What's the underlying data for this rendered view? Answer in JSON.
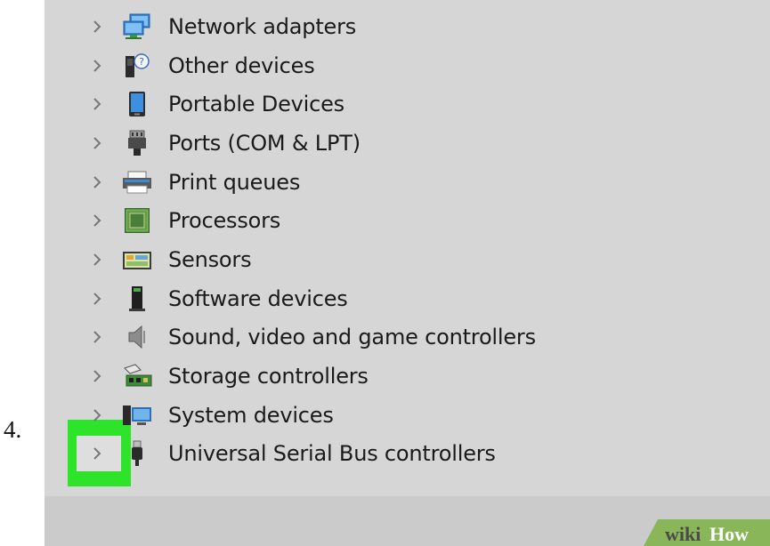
{
  "step": {
    "number": "4."
  },
  "device_tree": {
    "items": [
      {
        "label": "Network adapters",
        "icon": "network-adapter-icon"
      },
      {
        "label": "Other devices",
        "icon": "unknown-device-icon"
      },
      {
        "label": "Portable Devices",
        "icon": "portable-device-icon"
      },
      {
        "label": "Ports (COM & LPT)",
        "icon": "port-icon"
      },
      {
        "label": "Print queues",
        "icon": "printer-icon"
      },
      {
        "label": "Processors",
        "icon": "processor-icon"
      },
      {
        "label": "Sensors",
        "icon": "sensor-icon"
      },
      {
        "label": "Software devices",
        "icon": "software-device-icon"
      },
      {
        "label": "Sound, video and game controllers",
        "icon": "speaker-icon"
      },
      {
        "label": "Storage controllers",
        "icon": "storage-controller-icon"
      },
      {
        "label": "System devices",
        "icon": "system-device-icon"
      },
      {
        "label": "Universal Serial Bus controllers",
        "icon": "usb-icon"
      }
    ],
    "highlighted_index": 11,
    "highlight_color": "#2ee42b"
  },
  "watermark": {
    "brand_a": "wiki",
    "brand_b": "How"
  }
}
